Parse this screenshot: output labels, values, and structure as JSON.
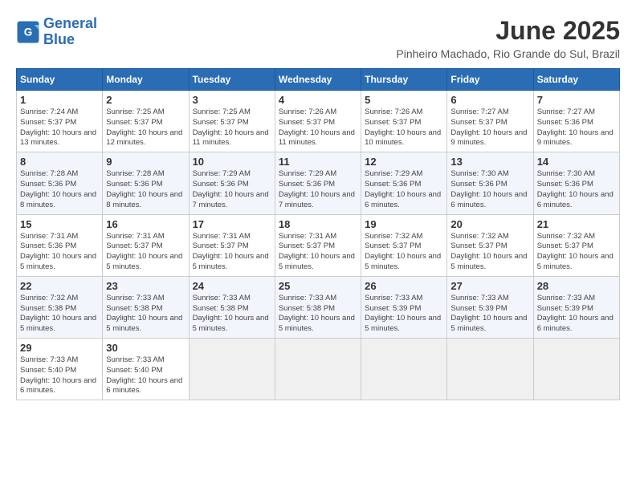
{
  "logo": {
    "line1": "General",
    "line2": "Blue"
  },
  "title": "June 2025",
  "subtitle": "Pinheiro Machado, Rio Grande do Sul, Brazil",
  "weekdays": [
    "Sunday",
    "Monday",
    "Tuesday",
    "Wednesday",
    "Thursday",
    "Friday",
    "Saturday"
  ],
  "weeks": [
    [
      {
        "day": "1",
        "rise": "7:24 AM",
        "set": "5:37 PM",
        "daylight": "10 hours and 13 minutes."
      },
      {
        "day": "2",
        "rise": "7:25 AM",
        "set": "5:37 PM",
        "daylight": "10 hours and 12 minutes."
      },
      {
        "day": "3",
        "rise": "7:25 AM",
        "set": "5:37 PM",
        "daylight": "10 hours and 11 minutes."
      },
      {
        "day": "4",
        "rise": "7:26 AM",
        "set": "5:37 PM",
        "daylight": "10 hours and 11 minutes."
      },
      {
        "day": "5",
        "rise": "7:26 AM",
        "set": "5:37 PM",
        "daylight": "10 hours and 10 minutes."
      },
      {
        "day": "6",
        "rise": "7:27 AM",
        "set": "5:37 PM",
        "daylight": "10 hours and 9 minutes."
      },
      {
        "day": "7",
        "rise": "7:27 AM",
        "set": "5:36 PM",
        "daylight": "10 hours and 9 minutes."
      }
    ],
    [
      {
        "day": "8",
        "rise": "7:28 AM",
        "set": "5:36 PM",
        "daylight": "10 hours and 8 minutes."
      },
      {
        "day": "9",
        "rise": "7:28 AM",
        "set": "5:36 PM",
        "daylight": "10 hours and 8 minutes."
      },
      {
        "day": "10",
        "rise": "7:29 AM",
        "set": "5:36 PM",
        "daylight": "10 hours and 7 minutes."
      },
      {
        "day": "11",
        "rise": "7:29 AM",
        "set": "5:36 PM",
        "daylight": "10 hours and 7 minutes."
      },
      {
        "day": "12",
        "rise": "7:29 AM",
        "set": "5:36 PM",
        "daylight": "10 hours and 6 minutes."
      },
      {
        "day": "13",
        "rise": "7:30 AM",
        "set": "5:36 PM",
        "daylight": "10 hours and 6 minutes."
      },
      {
        "day": "14",
        "rise": "7:30 AM",
        "set": "5:36 PM",
        "daylight": "10 hours and 6 minutes."
      }
    ],
    [
      {
        "day": "15",
        "rise": "7:31 AM",
        "set": "5:36 PM",
        "daylight": "10 hours and 5 minutes."
      },
      {
        "day": "16",
        "rise": "7:31 AM",
        "set": "5:37 PM",
        "daylight": "10 hours and 5 minutes."
      },
      {
        "day": "17",
        "rise": "7:31 AM",
        "set": "5:37 PM",
        "daylight": "10 hours and 5 minutes."
      },
      {
        "day": "18",
        "rise": "7:31 AM",
        "set": "5:37 PM",
        "daylight": "10 hours and 5 minutes."
      },
      {
        "day": "19",
        "rise": "7:32 AM",
        "set": "5:37 PM",
        "daylight": "10 hours and 5 minutes."
      },
      {
        "day": "20",
        "rise": "7:32 AM",
        "set": "5:37 PM",
        "daylight": "10 hours and 5 minutes."
      },
      {
        "day": "21",
        "rise": "7:32 AM",
        "set": "5:37 PM",
        "daylight": "10 hours and 5 minutes."
      }
    ],
    [
      {
        "day": "22",
        "rise": "7:32 AM",
        "set": "5:38 PM",
        "daylight": "10 hours and 5 minutes."
      },
      {
        "day": "23",
        "rise": "7:33 AM",
        "set": "5:38 PM",
        "daylight": "10 hours and 5 minutes."
      },
      {
        "day": "24",
        "rise": "7:33 AM",
        "set": "5:38 PM",
        "daylight": "10 hours and 5 minutes."
      },
      {
        "day": "25",
        "rise": "7:33 AM",
        "set": "5:38 PM",
        "daylight": "10 hours and 5 minutes."
      },
      {
        "day": "26",
        "rise": "7:33 AM",
        "set": "5:39 PM",
        "daylight": "10 hours and 5 minutes."
      },
      {
        "day": "27",
        "rise": "7:33 AM",
        "set": "5:39 PM",
        "daylight": "10 hours and 5 minutes."
      },
      {
        "day": "28",
        "rise": "7:33 AM",
        "set": "5:39 PM",
        "daylight": "10 hours and 6 minutes."
      }
    ],
    [
      {
        "day": "29",
        "rise": "7:33 AM",
        "set": "5:40 PM",
        "daylight": "10 hours and 6 minutes."
      },
      {
        "day": "30",
        "rise": "7:33 AM",
        "set": "5:40 PM",
        "daylight": "10 hours and 6 minutes."
      },
      null,
      null,
      null,
      null,
      null
    ]
  ]
}
